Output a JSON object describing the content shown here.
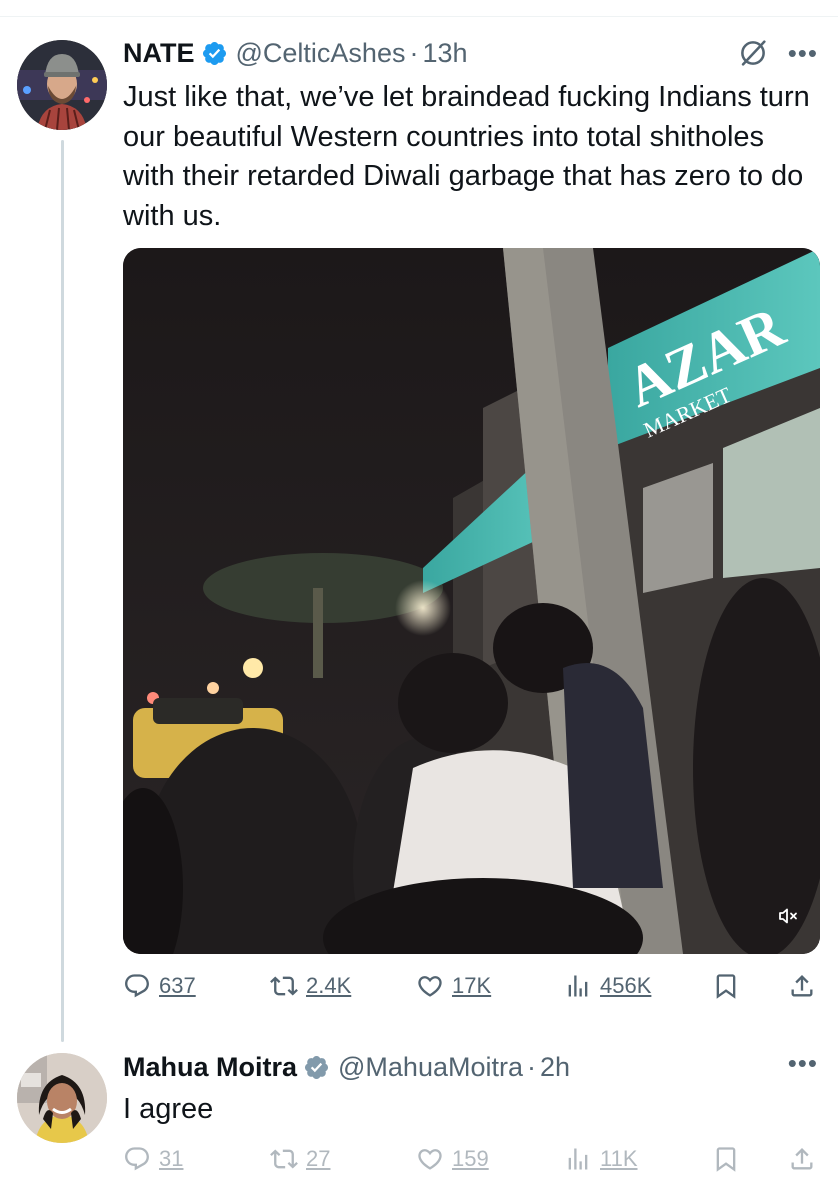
{
  "tweet": {
    "author_name": "NATE",
    "handle": "@CelticAshes",
    "separator": "·",
    "time": "13h",
    "text": "Just like that, we’ve let braindead fucking Indians turn our beautiful Western countries into total shitholes with their retarded Diwali garbage that has zero to do with us.",
    "media": {
      "sign_text": "AZAR",
      "sign_subtext": "MARKET"
    },
    "stats": {
      "replies": "637",
      "reposts": "2.4K",
      "likes": "17K",
      "views": "456K"
    }
  },
  "reply": {
    "author_name": "Mahua Moitra",
    "handle": "@MahuaMoitra",
    "separator": "·",
    "time": "2h",
    "text": "I agree",
    "stats": {
      "replies": "31",
      "reposts": "27",
      "likes": "159",
      "views": "11K"
    }
  },
  "colors": {
    "verified_blue": "#1d9bf0",
    "verified_gray": "#829aab",
    "secondary_text": "#536471",
    "thread_line": "#cfd9de"
  },
  "icons": [
    "verified-badge-icon",
    "grok-icon",
    "more-icon",
    "reply-icon",
    "repost-icon",
    "like-icon",
    "views-icon",
    "bookmark-icon",
    "share-icon",
    "mute-icon"
  ]
}
